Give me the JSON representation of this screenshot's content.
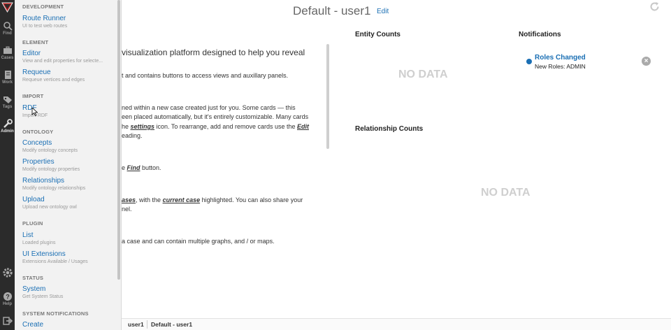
{
  "nav": {
    "items": [
      {
        "label": "Find",
        "icon": "search-icon"
      },
      {
        "label": "Cases",
        "icon": "briefcase-icon"
      },
      {
        "label": "Work",
        "icon": "document-icon"
      },
      {
        "label": "Tags",
        "icon": "tag-icon"
      },
      {
        "label": "Admin",
        "icon": "wrench-icon"
      },
      {
        "label": "",
        "icon": "gear-icon"
      },
      {
        "label": "Help",
        "icon": "help-icon"
      },
      {
        "label": "",
        "icon": "logout-icon"
      }
    ],
    "active": "Admin"
  },
  "menu": {
    "development": {
      "heading": "DEVELOPMENT",
      "items": [
        {
          "title": "Route Runner",
          "desc": "UI to test web routes"
        }
      ]
    },
    "element": {
      "heading": "ELEMENT",
      "items": [
        {
          "title": "Editor",
          "desc": "View and edit properties for selecte..."
        },
        {
          "title": "Requeue",
          "desc": "Requeue vertices and edges"
        }
      ]
    },
    "import": {
      "heading": "IMPORT",
      "items": [
        {
          "title": "RDF",
          "desc": "Import RDF"
        }
      ]
    },
    "ontology": {
      "heading": "ONTOLOGY",
      "items": [
        {
          "title": "Concepts",
          "desc": "Modify ontology concepts"
        },
        {
          "title": "Properties",
          "desc": "Modify ontology properties"
        },
        {
          "title": "Relationships",
          "desc": "Modify ontology relationships"
        },
        {
          "title": "Upload",
          "desc": "Upload new ontology owl"
        }
      ]
    },
    "plugin": {
      "heading": "PLUGIN",
      "items": [
        {
          "title": "List",
          "desc": "Loaded plugins"
        },
        {
          "title": "UI Extensions",
          "desc": "Extensions Available / Usages"
        }
      ]
    },
    "status": {
      "heading": "STATUS",
      "items": [
        {
          "title": "System",
          "desc": "Get System Status"
        }
      ]
    },
    "system_notifications": {
      "heading": "SYSTEM NOTIFICATIONS",
      "items": [
        {
          "title": "Create",
          "desc": ""
        }
      ]
    }
  },
  "header": {
    "title": "Default - user1",
    "edit_label": "Edit"
  },
  "welcome": {
    "line1": "visualization platform designed to help you reveal",
    "line2": "t and contains buttons to access views and auxillary panels.",
    "line3": "ned within a new case created just for you. Some cards — this",
    "line4": "een placed automatically, but it's entirely customizable. Many cards",
    "line5_a": "he ",
    "line5_b": "settings",
    "line5_c": " icon. To rearrange, add and remove cards use the ",
    "line5_d": "Edit",
    "line6": "eading.",
    "line7_a": "e ",
    "line7_b": "Find",
    "line7_c": " button.",
    "line8_a": "ases",
    "line8_b": ", with the ",
    "line8_c": "current case",
    "line8_d": " highlighted. You can also share your",
    "line9": "nel.",
    "line10": "a case and can contain multiple graphs, and / or maps."
  },
  "cards": {
    "entity_counts": {
      "title": "Entity Counts",
      "empty": "NO DATA"
    },
    "notifications": {
      "title": "Notifications"
    },
    "relationship_counts": {
      "title": "Relationship Counts",
      "empty": "NO DATA"
    }
  },
  "notification": {
    "title": "Roles Changed",
    "body": "New Roles: ADMIN",
    "close_glyph": "×"
  },
  "statusbar": {
    "user": "user1",
    "case": "Default - user1"
  },
  "colors": {
    "link": "#1a6fb4",
    "nav_bg": "#2b2b2b",
    "menu_bg": "#f2f2f2",
    "no_data": "#cfcfcf"
  }
}
